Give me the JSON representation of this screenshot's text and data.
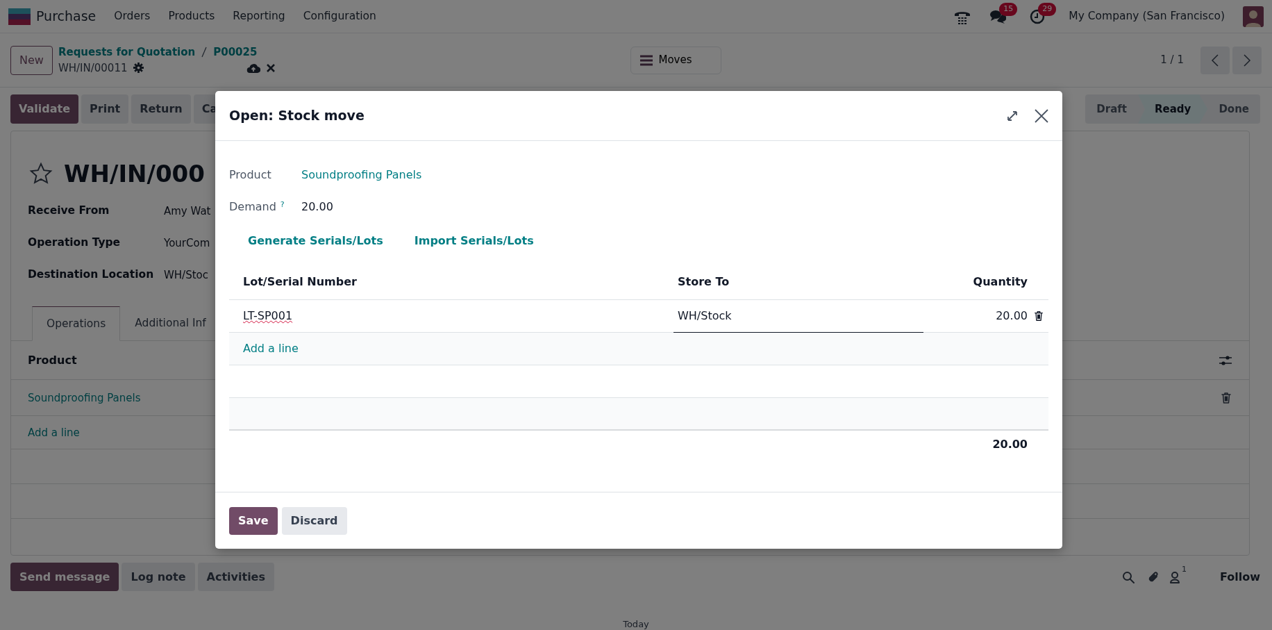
{
  "app_bar": {
    "app_name": "Purchase",
    "menus": [
      "Orders",
      "Products",
      "Reporting",
      "Configuration"
    ],
    "messages_badge": "15",
    "activities_badge": "29",
    "company": "My Company (San Francisco)"
  },
  "control_panel": {
    "new_button": "New",
    "breadcrumbs": [
      "Requests for Quotation",
      "P00025"
    ],
    "record_name": "WH/IN/00011",
    "smart_button": "Moves",
    "pager": "1 / 1"
  },
  "action_buttons": [
    {
      "label": "Validate",
      "primary": true
    },
    {
      "label": "Print",
      "primary": false
    },
    {
      "label": "Return",
      "primary": false
    },
    {
      "label": "Ca",
      "primary": false
    }
  ],
  "statusbar": [
    {
      "label": "Draft",
      "selected": false
    },
    {
      "label": "Ready",
      "selected": true
    },
    {
      "label": "Done",
      "selected": false
    }
  ],
  "form": {
    "title": "WH/IN/000",
    "favorite": false,
    "fields": [
      {
        "label": "Receive From",
        "value": "Amy Wat"
      },
      {
        "label": "Operation Type",
        "value": "YourCom"
      },
      {
        "label": "Destination Location",
        "value": "WH/Stoc"
      }
    ],
    "tabs": [
      {
        "label": "Operations",
        "selected": true
      },
      {
        "label": "Additional Inf",
        "selected": false
      }
    ],
    "table": {
      "columns": [
        "Product"
      ],
      "rows": [
        {
          "product": "Soundproofing Panels"
        }
      ],
      "add_line": "Add a line"
    }
  },
  "chatter": {
    "buttons": [
      {
        "label": "Send message",
        "primary": true
      },
      {
        "label": "Log note",
        "primary": false
      },
      {
        "label": "Activities",
        "primary": false
      }
    ],
    "followers_count": "1",
    "follow": "Follow",
    "date_separator": "Today"
  },
  "dialog": {
    "title": "Open: Stock move",
    "fields": [
      {
        "label": "Product",
        "value": "Soundproofing Panels",
        "kind": "link"
      },
      {
        "label": "Demand",
        "help_mark": "?",
        "value": "20.00",
        "kind": "text"
      }
    ],
    "links": [
      "Generate Serials/Lots",
      "Import Serials/Lots"
    ],
    "table": {
      "columns": [
        "Lot/Serial Number",
        "Store To",
        "Quantity"
      ],
      "rows": [
        {
          "lot": "LT-SP001",
          "store_to": "WH/Stock",
          "quantity": "20.00",
          "editing": true
        }
      ],
      "add_line": "Add a line",
      "total": "20.00"
    },
    "buttons": [
      {
        "label": "Save",
        "primary": true
      },
      {
        "label": "Discard",
        "primary": false
      }
    ]
  }
}
